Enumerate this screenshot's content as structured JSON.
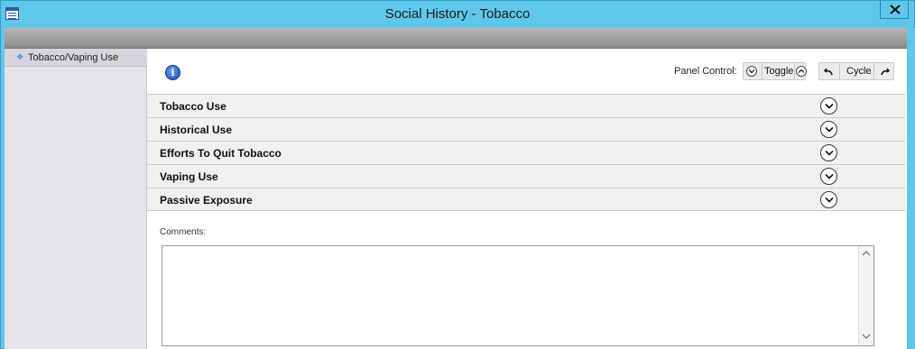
{
  "window": {
    "title": "Social History - Tobacco",
    "icon": "app-grid-icon",
    "colors": {
      "titlebar": "#5fc8ea",
      "band": "#a0a0a0",
      "sidebar": "#e3e3ea"
    }
  },
  "sidebar": {
    "items": [
      {
        "label": "Tobacco/Vaping Use",
        "icon": "diamond-bullet-icon"
      }
    ]
  },
  "toolbar": {
    "info_icon": "info-icon",
    "panel_control_label": "Panel Control:",
    "toggle_label": "Toggle",
    "cycle_label": "Cycle"
  },
  "sections": [
    {
      "label": "Tobacco Use",
      "icon": "chevron-down-icon"
    },
    {
      "label": "Historical Use",
      "icon": "chevron-down-icon"
    },
    {
      "label": "Efforts To Quit Tobacco",
      "icon": "chevron-down-icon"
    },
    {
      "label": "Vaping Use",
      "icon": "chevron-down-icon"
    },
    {
      "label": "Passive Exposure",
      "icon": "chevron-down-icon"
    }
  ],
  "comments": {
    "label": "Comments:",
    "value": ""
  }
}
